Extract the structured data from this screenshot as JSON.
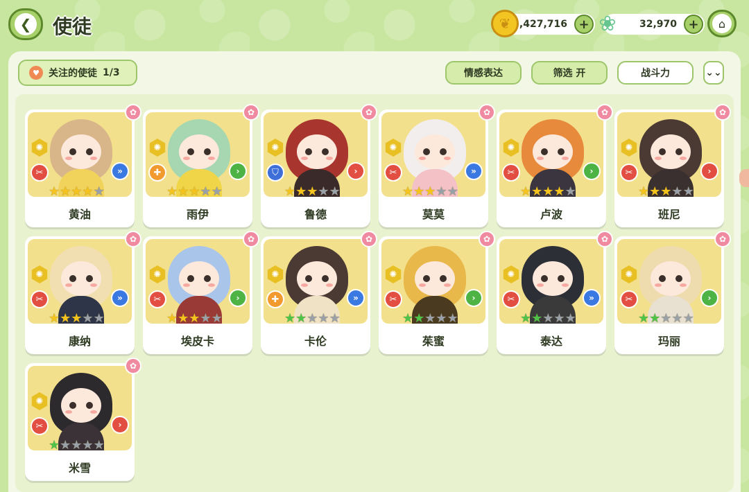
{
  "header": {
    "title": "使徒",
    "back_icon": "back-arrow-icon",
    "gold": {
      "value": "5,427,716",
      "icon": "gold-coin-icon"
    },
    "gems": {
      "value": "32,970",
      "icon": "crystal-flower-icon"
    },
    "home_icon": "home-icon"
  },
  "toolbar": {
    "follow_label": "关注的使徒",
    "follow_count": "1/3",
    "emote_label": "情感表达",
    "filter_label": "筛选 开",
    "power_label": "战斗力",
    "expand_icon": "double-chevron-down-icon"
  },
  "colors": {
    "background": "#c9e6a1",
    "panel": "#f3f7e6",
    "card_art": "#f2e08c",
    "star_gold": "#f5c31d",
    "star_green": "#4fc24a"
  },
  "characters": [
    {
      "name": "黄油",
      "stars": 4,
      "star_color": "gold",
      "role": "attack",
      "class": "speed",
      "hair": "#d9b68a",
      "body": "#f1d25b"
    },
    {
      "name": "雨伊",
      "stars": 3,
      "star_color": "gold",
      "role": "heal",
      "class": "green",
      "hair": "#a7d7b0",
      "body": "#f0d548"
    },
    {
      "name": "鲁德",
      "stars": 3,
      "star_color": "gold",
      "role": "defense",
      "class": "red",
      "hair": "#a8362f",
      "body": "#3b2a2a"
    },
    {
      "name": "莫莫",
      "stars": 3,
      "star_color": "gold",
      "role": "attack",
      "class": "speed",
      "hair": "#f3eeee",
      "body": "#f4c1c6"
    },
    {
      "name": "卢波",
      "stars": 4,
      "star_color": "gold",
      "role": "attack",
      "class": "green",
      "hair": "#e88a3c",
      "body": "#3b3540"
    },
    {
      "name": "班尼",
      "stars": 3,
      "star_color": "gold",
      "role": "attack",
      "class": "red",
      "hair": "#4b3a33",
      "body": "#3a3030"
    },
    {
      "name": "康纳",
      "stars": 3,
      "star_color": "gold",
      "role": "attack",
      "class": "speed",
      "hair": "#f1dfb2",
      "body": "#2e3548"
    },
    {
      "name": "埃皮卡",
      "stars": 3,
      "star_color": "gold",
      "role": "attack",
      "class": "green",
      "hair": "#a9c5ea",
      "body": "#9a3a36"
    },
    {
      "name": "卡伦",
      "stars": 2,
      "star_color": "green",
      "role": "heal",
      "class": "speed",
      "hair": "#4b3a33",
      "body": "#f0e2c4"
    },
    {
      "name": "茱蜜",
      "stars": 2,
      "star_color": "green",
      "role": "attack",
      "class": "green",
      "hair": "#e9b84a",
      "body": "#4a3a20"
    },
    {
      "name": "泰达",
      "stars": 2,
      "star_color": "green",
      "role": "attack",
      "class": "speed",
      "hair": "#2c2f36",
      "body": "#3a3a3a"
    },
    {
      "name": "玛丽",
      "stars": 2,
      "star_color": "green",
      "role": "attack",
      "class": "green",
      "hair": "#efdcae",
      "body": "#e8e0d0"
    },
    {
      "name": "米雪",
      "stars": 1,
      "star_color": "green",
      "role": "attack",
      "class": "red",
      "hair": "#2d2a2e",
      "body": "#3a3236"
    }
  ]
}
